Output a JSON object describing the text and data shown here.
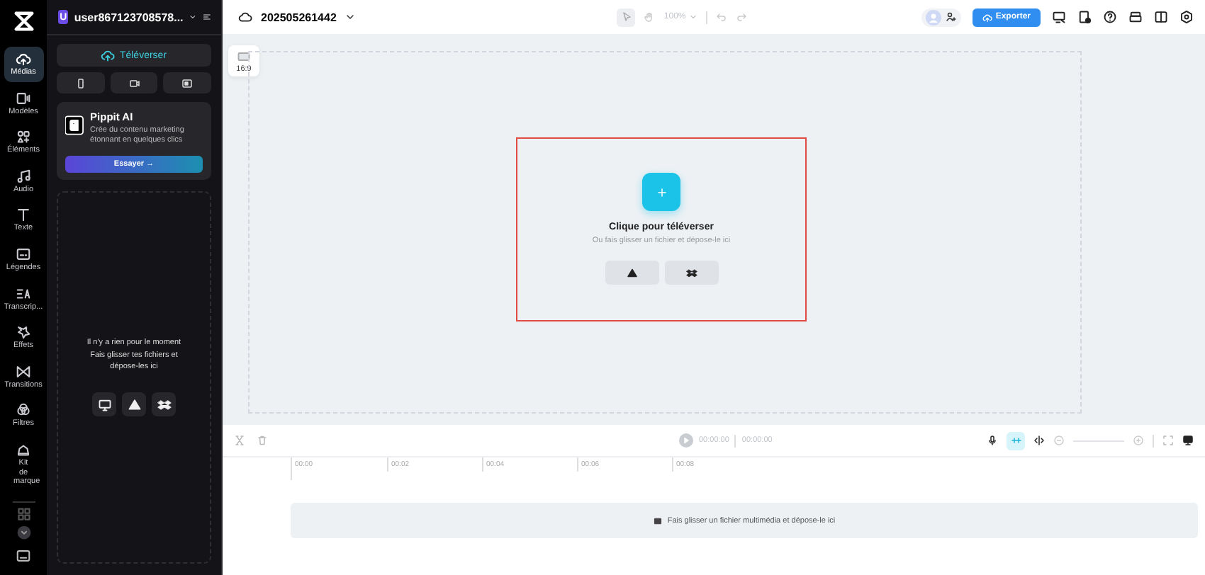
{
  "project": {
    "name": "202505261442"
  },
  "user": {
    "initial": "U",
    "name": "user867123708578..."
  },
  "rail": [
    {
      "label": "Médias",
      "selected": true
    },
    {
      "label": "Modèles",
      "selected": false
    },
    {
      "label": "Éléments",
      "selected": false
    },
    {
      "label": "Audio",
      "selected": false
    },
    {
      "label": "Texte",
      "selected": false
    },
    {
      "label": "Légendes",
      "selected": false
    },
    {
      "label": "Transcrip...",
      "selected": false
    },
    {
      "label": "Effets",
      "selected": false
    },
    {
      "label": "Transitions",
      "selected": false
    },
    {
      "label": "Filtres",
      "selected": false
    },
    {
      "label": "Kit de marque",
      "selected": false
    }
  ],
  "panel": {
    "upload_button": "Téléverser",
    "promo": {
      "title": "Pippit AI",
      "text": "Crée du contenu marketing étonnant en quelques clics",
      "button": "Essayer →"
    },
    "empty": {
      "title": "Il n'y a rien pour le moment",
      "text": "Fais glisser tes fichiers et dépose-les ici"
    }
  },
  "toolbar": {
    "zoom": "100%",
    "export": "Exporter"
  },
  "canvas": {
    "ratio": "16:9",
    "upload_title": "Clique pour téléverser",
    "upload_hint": "Ou fais glisser un fichier et dépose-le ici"
  },
  "timeline": {
    "current": "00:00:00",
    "total": "00:00:00",
    "ticks": [
      "00:00",
      "00:02",
      "00:04",
      "00:06",
      "00:08"
    ],
    "drop_hint": "Fais glisser un fichier multimédia et dépose-le ici"
  }
}
